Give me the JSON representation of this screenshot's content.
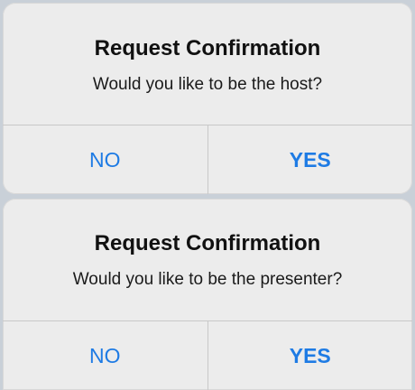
{
  "dialogs": [
    {
      "title": "Request Confirmation",
      "message": "Would you like to be the host?",
      "no_label": "NO",
      "yes_label": "YES"
    },
    {
      "title": "Request Confirmation",
      "message": "Would you like to be the presenter?",
      "no_label": "NO",
      "yes_label": "YES"
    }
  ],
  "colors": {
    "button_text": "#1e7be4",
    "dialog_background": "#ececec",
    "divider": "#c8c8c8"
  }
}
